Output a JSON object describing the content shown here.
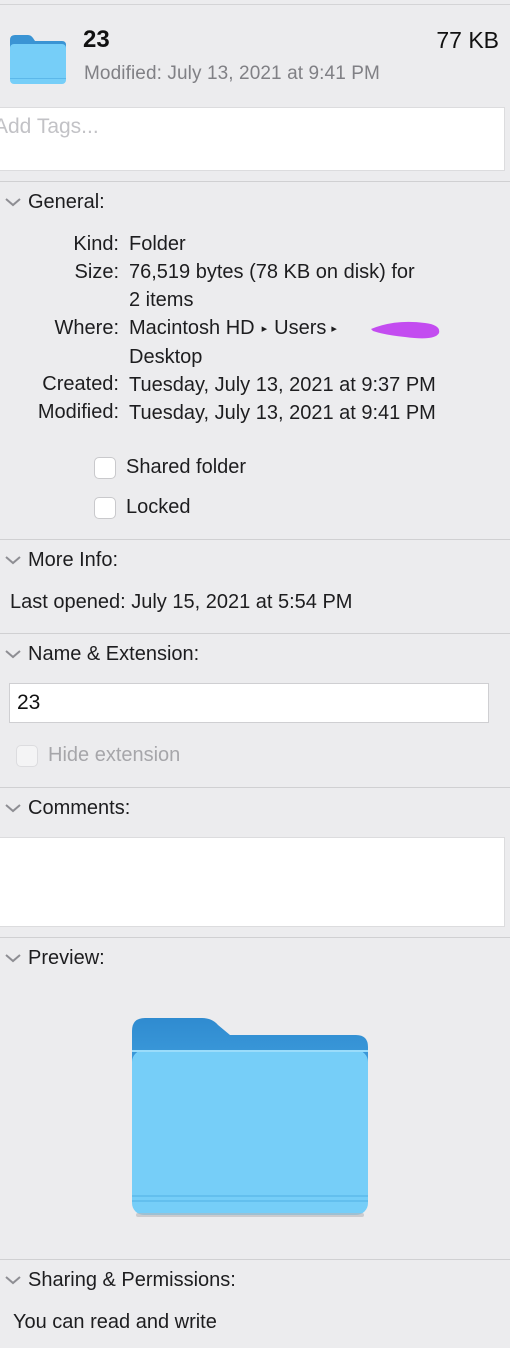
{
  "header": {
    "name": "23",
    "size": "77 KB",
    "modified": "Modified: July 13, 2021 at 9:41 PM",
    "icon": "folder-icon"
  },
  "tags": {
    "placeholder": "Add Tags..."
  },
  "general": {
    "title": "General:",
    "kind_key": "Kind:",
    "kind_val": "Folder",
    "size_key": "Size:",
    "size_val_1": "76,519 bytes (78 KB on disk) for",
    "size_val_2": "2 items",
    "where_key": "Where:",
    "where_path_1": "Macintosh HD",
    "where_path_2": "Users",
    "where_sep": "▸",
    "where_val_2": "Desktop",
    "created_key": "Created:",
    "created_val": "Tuesday, July 13, 2021 at 9:37 PM",
    "modified_key": "Modified:",
    "modified_val": "Tuesday, July 13, 2021 at 9:41 PM",
    "shared_label": "Shared folder",
    "shared_checked": false,
    "locked_label": "Locked",
    "locked_checked": false
  },
  "more_info": {
    "title": "More Info:",
    "last_opened": "Last opened: July 15, 2021 at 5:54 PM"
  },
  "name_ext": {
    "title": "Name & Extension:",
    "value": "23",
    "hide_ext_label": "Hide extension",
    "hide_ext_checked": false
  },
  "comments": {
    "title": "Comments:"
  },
  "preview": {
    "title": "Preview:",
    "icon": "folder-preview-icon"
  },
  "sharing": {
    "title": "Sharing & Permissions:",
    "status": "You can read and write"
  },
  "colors": {
    "folder_light": "#76cef8",
    "folder_dark": "#3a94d4",
    "redaction": "#c34cf0",
    "background": "#ececee"
  }
}
